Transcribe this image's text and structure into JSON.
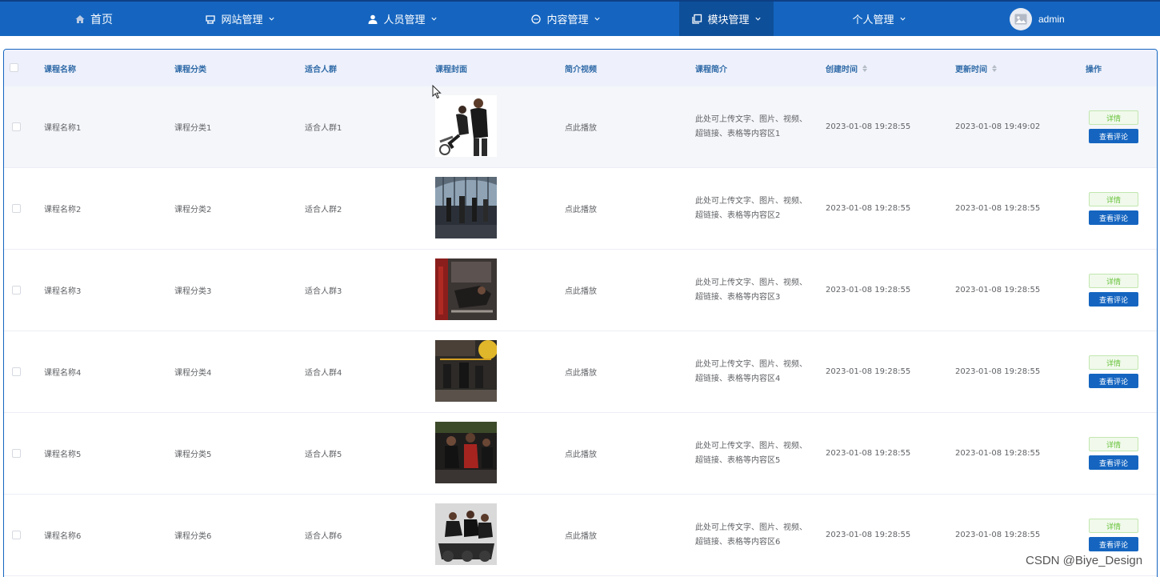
{
  "nav": {
    "home": "首页",
    "site": "网站管理",
    "people": "人员管理",
    "content": "内容管理",
    "module": "模块管理",
    "personal": "个人管理",
    "user": "admin",
    "accent": "#1565c0",
    "active_bg": "#0e4f99"
  },
  "table": {
    "headers": {
      "name": "课程名称",
      "category": "课程分类",
      "audience": "适合人群",
      "cover": "课程封面",
      "video": "简介视频",
      "intro": "课程简介",
      "created": "创建时间",
      "updated": "更新时间",
      "ops": "操作"
    },
    "rows": [
      {
        "name": "课程名称1",
        "category": "课程分类1",
        "audience": "适合人群1",
        "video": "点此播放",
        "intro": "此处可上传文字、图片、视频、超链接、表格等内容区1",
        "created": "2023-01-08 19:28:55",
        "updated": "2023-01-08 19:49:02",
        "detail": "详情",
        "review": "查看评论"
      },
      {
        "name": "课程名称2",
        "category": "课程分类2",
        "audience": "适合人群2",
        "video": "点此播放",
        "intro": "此处可上传文字、图片、视频、超链接、表格等内容区2",
        "created": "2023-01-08 19:28:55",
        "updated": "2023-01-08 19:28:55",
        "detail": "详情",
        "review": "查看评论"
      },
      {
        "name": "课程名称3",
        "category": "课程分类3",
        "audience": "适合人群3",
        "video": "点此播放",
        "intro": "此处可上传文字、图片、视频、超链接、表格等内容区3",
        "created": "2023-01-08 19:28:55",
        "updated": "2023-01-08 19:28:55",
        "detail": "详情",
        "review": "查看评论"
      },
      {
        "name": "课程名称4",
        "category": "课程分类4",
        "audience": "适合人群4",
        "video": "点此播放",
        "intro": "此处可上传文字、图片、视频、超链接、表格等内容区4",
        "created": "2023-01-08 19:28:55",
        "updated": "2023-01-08 19:28:55",
        "detail": "详情",
        "review": "查看评论"
      },
      {
        "name": "课程名称5",
        "category": "课程分类5",
        "audience": "适合人群5",
        "video": "点此播放",
        "intro": "此处可上传文字、图片、视频、超链接、表格等内容区5",
        "created": "2023-01-08 19:28:55",
        "updated": "2023-01-08 19:28:55",
        "detail": "详情",
        "review": "查看评论"
      },
      {
        "name": "课程名称6",
        "category": "课程分类6",
        "audience": "适合人群6",
        "video": "点此播放",
        "intro": "此处可上传文字、图片、视频、超链接、表格等内容区6",
        "created": "2023-01-08 19:28:55",
        "updated": "2023-01-08 19:28:55",
        "detail": "详情",
        "review": "查看评论"
      }
    ]
  },
  "watermark": "CSDN @Biye_Design"
}
